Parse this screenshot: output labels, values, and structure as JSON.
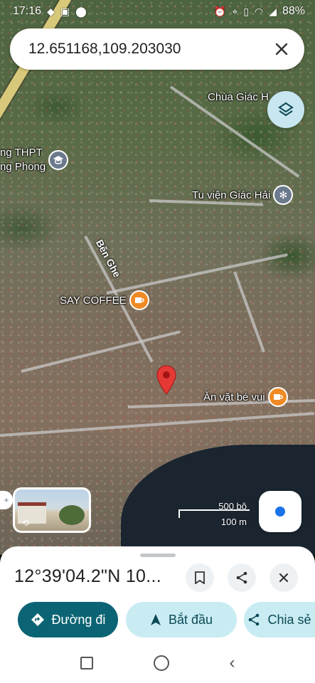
{
  "status_bar": {
    "time": "17:16",
    "battery": "88%"
  },
  "search": {
    "query": "12.651168,109.203030"
  },
  "map": {
    "pois": [
      {
        "label": "Chùa Giác H",
        "icon": "temple-icon"
      },
      {
        "label": "ng THPT",
        "label2": "ng Phong",
        "icon": "school-icon"
      },
      {
        "label": "Tu viện Giác Hải",
        "icon": "temple-icon"
      },
      {
        "label": "SAY COFFEE",
        "icon": "coffee-icon"
      },
      {
        "label": "Ăn vặt bé vui",
        "icon": "coffee-icon"
      }
    ],
    "road_name": "Bến Ghe",
    "scale": {
      "feet": "500 bộ",
      "meters": "100 m"
    }
  },
  "sheet": {
    "title": "12°39'04.2\"N 10...",
    "buttons": {
      "directions": "Đường đi",
      "start": "Bắt đầu",
      "share": "Chia sẻ"
    }
  },
  "colors": {
    "primary": "#0b6473",
    "secondary": "#c9ecf3",
    "pin": "#e53935",
    "poi_orange": "#f08a24"
  }
}
